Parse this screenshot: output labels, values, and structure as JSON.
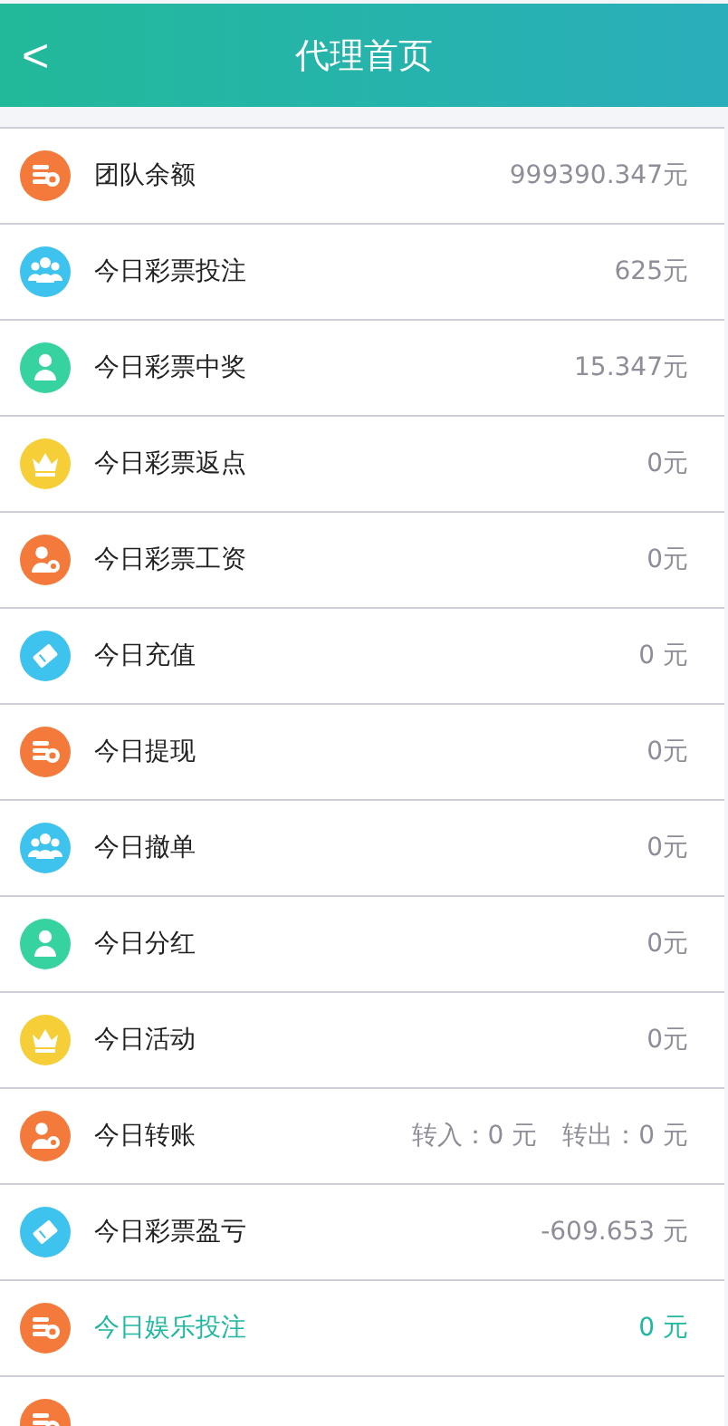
{
  "header": {
    "back": "<",
    "title": "代理首页"
  },
  "rows": [
    {
      "kind": "coins",
      "color": "#f47a3c",
      "label": "团队余额",
      "values": [
        "999390.347元"
      ],
      "selected": false
    },
    {
      "kind": "group",
      "color": "#3ec3ef",
      "label": "今日彩票投注",
      "values": [
        "625元"
      ],
      "selected": false
    },
    {
      "kind": "person",
      "color": "#36d3a0",
      "label": "今日彩票中奖",
      "values": [
        "15.347元"
      ],
      "selected": false
    },
    {
      "kind": "crown",
      "color": "#f6cf38",
      "label": "今日彩票返点",
      "values": [
        "0元"
      ],
      "selected": false
    },
    {
      "kind": "person-coin",
      "color": "#f47a3c",
      "label": "今日彩票工资",
      "values": [
        "0元"
      ],
      "selected": false
    },
    {
      "kind": "ticket",
      "color": "#3ec3ef",
      "label": "今日充值",
      "values": [
        "0 元"
      ],
      "selected": false
    },
    {
      "kind": "coins",
      "color": "#f47a3c",
      "label": "今日提现",
      "values": [
        "0元"
      ],
      "selected": false
    },
    {
      "kind": "group",
      "color": "#3ec3ef",
      "label": "今日撤单",
      "values": [
        "0元"
      ],
      "selected": false
    },
    {
      "kind": "person",
      "color": "#36d3a0",
      "label": "今日分红",
      "values": [
        "0元"
      ],
      "selected": false
    },
    {
      "kind": "crown",
      "color": "#f6cf38",
      "label": "今日活动",
      "values": [
        "0元"
      ],
      "selected": false
    },
    {
      "kind": "person-coin",
      "color": "#f47a3c",
      "label": "今日转账",
      "values": [
        "转入：0 元",
        "转出：0 元"
      ],
      "selected": false
    },
    {
      "kind": "ticket",
      "color": "#3ec3ef",
      "label": "今日彩票盈亏",
      "values": [
        "-609.653 元"
      ],
      "selected": false
    },
    {
      "kind": "coins",
      "color": "#f47a3c",
      "label": "今日娱乐投注",
      "values": [
        "0 元"
      ],
      "selected": true
    },
    {
      "kind": "coins",
      "color": "#f47a3c"
    }
  ]
}
